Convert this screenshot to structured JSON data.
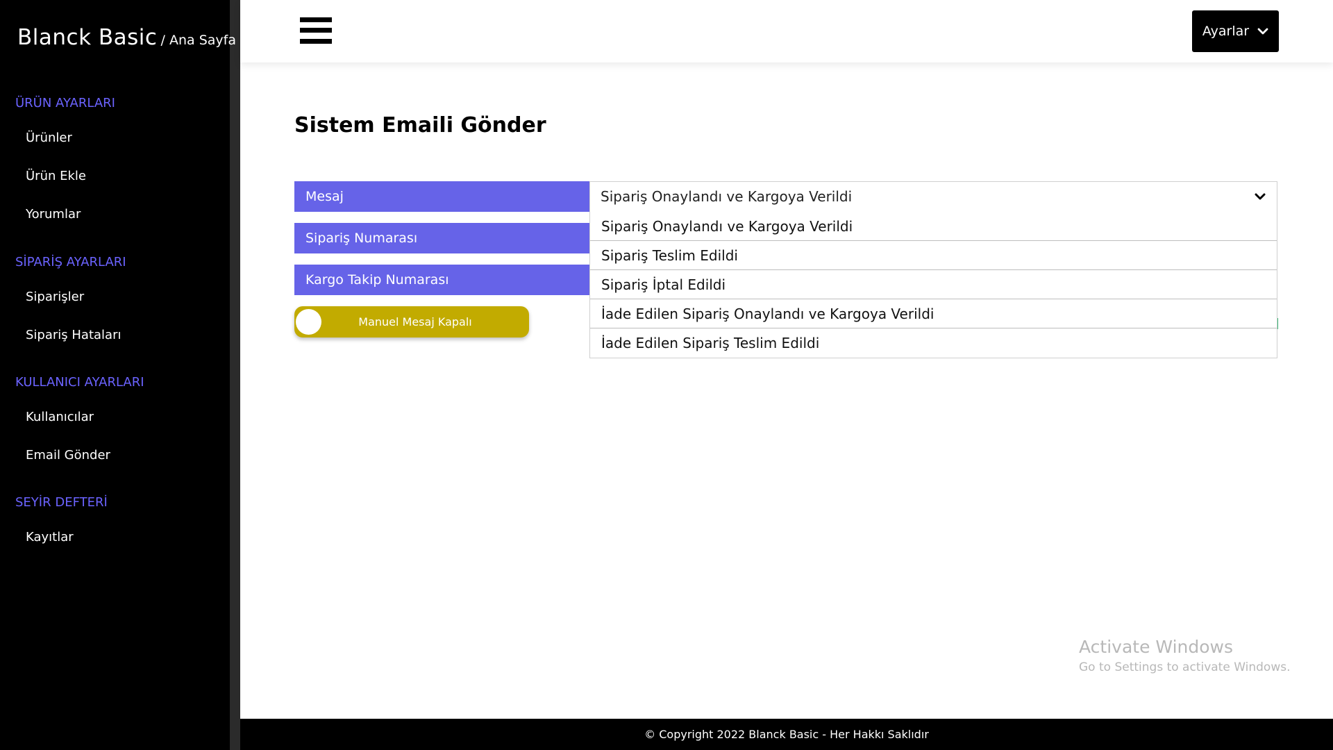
{
  "brand": {
    "name": "Blanck Basic",
    "breadcrumb": "/ Ana Sayfa"
  },
  "sidebar": {
    "sections": [
      {
        "title": "ÜRÜN AYARLARI",
        "items": [
          "Ürünler",
          "Ürün Ekle",
          "Yorumlar"
        ]
      },
      {
        "title": "SİPARİŞ AYARLARI",
        "items": [
          "Siparişler",
          "Sipariş Hataları"
        ]
      },
      {
        "title": "KULLANICI AYARLARI",
        "items": [
          "Kullanıcılar",
          "Email Gönder"
        ]
      },
      {
        "title": "SEYİR DEFTERİ",
        "items": [
          "Kayıtlar"
        ]
      }
    ]
  },
  "header": {
    "settings_label": "Ayarlar"
  },
  "main": {
    "title": "Sistem Emaili Gönder",
    "fields": {
      "message_label": "Mesaj",
      "order_number_label": "Sipariş Numarası",
      "tracking_number_label": "Kargo Takip Numarası"
    },
    "select": {
      "value": "Sipariş Onaylandı ve Kargoya Verildi",
      "options": [
        "Sipariş Onaylandı ve Kargoya Verildi",
        "Sipariş Teslim Edildi",
        "Sipariş İptal Edildi",
        "İade Edilen Sipariş Onaylandı ve Kargoya Verildi",
        "İade Edilen Sipariş Teslim Edildi"
      ]
    },
    "toggle": {
      "label": "Manuel Mesaj Kapalı",
      "on": false,
      "color": "#c2ab00"
    }
  },
  "watermark": {
    "title": "Activate Windows",
    "subtitle": "Go to Settings to activate Windows."
  },
  "footer": {
    "text": "© Copyright 2022 Blanck Basic - Her Hakkı Saklıdır"
  },
  "colors": {
    "accent": "#6663e8",
    "section_title": "#6b63ff",
    "sidebar_bg": "#000000"
  }
}
